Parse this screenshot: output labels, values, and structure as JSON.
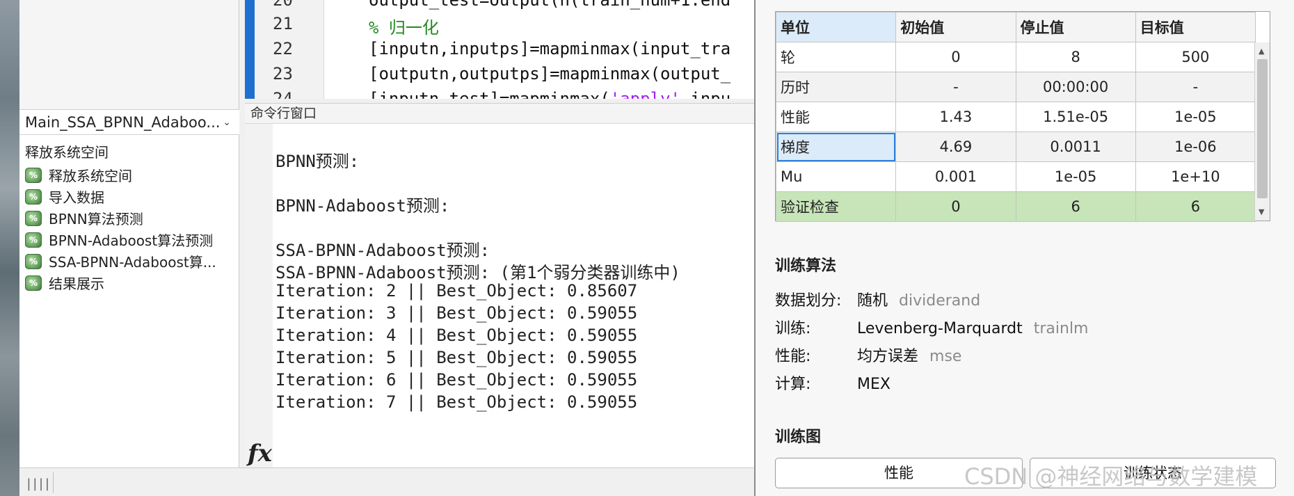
{
  "left_panel": {
    "file_name": "Main_SSA_BPNN_Adaboo...",
    "sections_header": "释放系统空间",
    "sections": [
      "释放系统空间",
      "导入数据",
      "BPNN算法预测",
      "BPNN-Adaboost算法预测",
      "SSA-BPNN-Adaboost算...",
      "结果展示"
    ],
    "section_icon": "%"
  },
  "editor": {
    "lines": [
      {
        "num": "20",
        "text": "output_test=output(n(train_num+1:end"
      },
      {
        "num": "21",
        "text": "% 归一化"
      },
      {
        "num": "22",
        "text": "[inputn,inputps]=mapminmax(input_tra"
      },
      {
        "num": "23",
        "text": "[outputn,outputps]=mapminmax(output_"
      },
      {
        "num": "24",
        "text_pre": "[inputn_test]=mapminmax(",
        "text_str": "'apply'",
        "text_post": ",inpu"
      }
    ]
  },
  "command_window": {
    "title": "命令行窗口",
    "lines": [
      "BPNN预测:",
      "BPNN-Adaboost预测:",
      "SSA-BPNN-Adaboost预测:",
      "SSA-BPNN-Adaboost预测: (第1个弱分类器训练中)",
      "Iteration: 2 || Best_Object: 0.85607",
      "Iteration: 3 || Best_Object: 0.59055",
      "Iteration: 4 || Best_Object: 0.59055",
      "Iteration: 5 || Best_Object: 0.59055",
      "Iteration: 6 || Best_Object: 0.59055",
      "Iteration: 7 || Best_Object: 0.59055"
    ],
    "fx": "fx"
  },
  "status_bar": {
    "grip": "||||"
  },
  "progress_table": {
    "headers": [
      "单位",
      "初始值",
      "停止值",
      "目标值"
    ],
    "rows": [
      {
        "name": "轮",
        "init": "0",
        "stop": "8",
        "target": "500"
      },
      {
        "name": "历时",
        "init": "-",
        "stop": "00:00:00",
        "target": "-"
      },
      {
        "name": "性能",
        "init": "1.43",
        "stop": "1.51e-05",
        "target": "1e-05"
      },
      {
        "name": "梯度",
        "init": "4.69",
        "stop": "0.0011",
        "target": "1e-06"
      },
      {
        "name": "Mu",
        "init": "0.001",
        "stop": "1e-05",
        "target": "1e+10"
      },
      {
        "name": "验证检查",
        "init": "0",
        "stop": "6",
        "target": "6"
      }
    ]
  },
  "training_algorithm": {
    "title": "训练算法",
    "rows": [
      {
        "key": "数据划分:",
        "value": "随机",
        "func": "dividerand"
      },
      {
        "key": "训练:",
        "value": "Levenberg-Marquardt",
        "func": "trainlm"
      },
      {
        "key": "性能:",
        "value": "均方误差",
        "func": "mse"
      },
      {
        "key": "计算:",
        "value": "MEX",
        "func": ""
      }
    ]
  },
  "training_plots": {
    "title": "训练图",
    "buttons": [
      "性能",
      "训练状态"
    ]
  },
  "watermark": "CSDN @神经网络与数学建模",
  "colors": {
    "accent": "#1f6fd1",
    "selected": "#dcebf9",
    "green_row": "#c7e5b8",
    "comment": "#228b22",
    "string": "#a020f0"
  }
}
